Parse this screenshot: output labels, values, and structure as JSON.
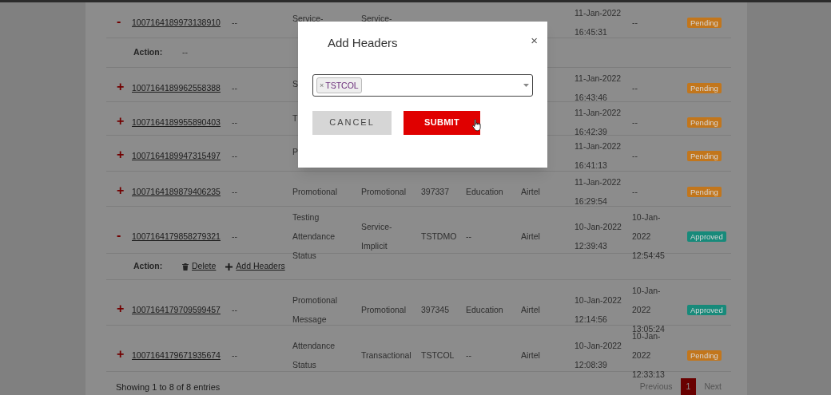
{
  "table": {
    "rows": [
      {
        "kind": "record",
        "toggle": "-",
        "id": "1007164189973138910",
        "col_2": "--",
        "template": "Service-",
        "category": "Service-",
        "created": "11-Jan-2022\n16:45:31",
        "approved": "--",
        "status": {
          "label": "Pending",
          "color": "#c2761c"
        }
      },
      {
        "kind": "action",
        "label": "Action:",
        "links": [
          {
            "kind": "text",
            "text": "--"
          }
        ]
      },
      {
        "kind": "record",
        "toggle": "+",
        "id": "1007164189962558388",
        "col_2": "--",
        "template": "S",
        "created": "11-Jan-2022\n16:43:46",
        "approved": "--",
        "status": {
          "label": "Pending",
          "color": "#c2761c"
        }
      },
      {
        "kind": "record",
        "toggle": "+",
        "id": "1007164189955890403",
        "col_2": "--",
        "template": "T",
        "created": "11-Jan-2022\n16:42:39",
        "approved": "--",
        "status": {
          "label": "Pending",
          "color": "#c2761c"
        }
      },
      {
        "kind": "record",
        "toggle": "+",
        "id": "1007164189947315497",
        "col_2": "--",
        "template": "P",
        "created": "11-Jan-2022\n16:41:13",
        "approved": "--",
        "status": {
          "label": "Pending",
          "color": "#c2761c"
        }
      },
      {
        "kind": "record",
        "toggle": "+",
        "id": "1007164189879406235",
        "col_2": "--",
        "template": "Promotional",
        "category": "Promotional",
        "header": "397337",
        "col_6": "Education",
        "operator": "Airtel",
        "created": "11-Jan-2022\n16:29:54",
        "approved": "--",
        "status": {
          "label": "Pending",
          "color": "#c2761c"
        }
      },
      {
        "kind": "record",
        "toggle": "-",
        "id": "1007164179858279321",
        "col_2": "--",
        "template": "Testing\nAttendance\nStatus",
        "category": "Service-\nImplicit",
        "header": "TSTDMO",
        "col_6": "--",
        "operator": "Airtel",
        "created": "10-Jan-2022\n12:39:43",
        "approved": "10-Jan-\n2022\n12:54:45",
        "status": {
          "label": "Approved",
          "color": "#178a7a"
        }
      },
      {
        "kind": "action",
        "label": "Action:",
        "links": [
          {
            "kind": "delete",
            "text": "Delete"
          },
          {
            "kind": "add",
            "text": "Add Headers"
          }
        ]
      },
      {
        "kind": "record",
        "toggle": "+",
        "id": "1007164179709599457",
        "col_2": "--",
        "template": "Promotional\nMessage",
        "category": "Promotional",
        "header": "397345",
        "col_6": "Education",
        "operator": "Airtel",
        "created": "10-Jan-2022\n12:14:56",
        "approved": "10-Jan-\n2022\n13:05:24",
        "status": {
          "label": "Approved",
          "color": "#178a7a"
        }
      },
      {
        "kind": "record",
        "toggle": "+",
        "id": "1007164179671935674",
        "col_2": "--",
        "template": "Attendance\nStatus",
        "category": "Transactional",
        "header": "TSTCOL",
        "col_6": "--",
        "operator": "Airtel",
        "created": "10-Jan-2022\n12:08:39",
        "approved": "10-Jan-\n2022\n12:33:13",
        "status": {
          "label": "Pending",
          "color": "#c2761c"
        }
      }
    ]
  },
  "footer": {
    "info": "Showing 1 to 8 of 8 entries",
    "pagination": [
      {
        "label": "Previous",
        "kind": "link",
        "selected": false
      },
      {
        "label": "1",
        "kind": "page",
        "selected": true
      },
      {
        "label": "Next",
        "kind": "link",
        "selected": false
      }
    ]
  },
  "dialog": {
    "title": "Add Headers",
    "close": "×",
    "field": {
      "chips": [
        {
          "remove": "×",
          "label": "TSTCOL"
        }
      ]
    },
    "buttons": [
      {
        "label": "CANCEL",
        "kind": "secondary"
      },
      {
        "label": "SUBMIT",
        "kind": "primary",
        "hovered": true
      }
    ]
  }
}
